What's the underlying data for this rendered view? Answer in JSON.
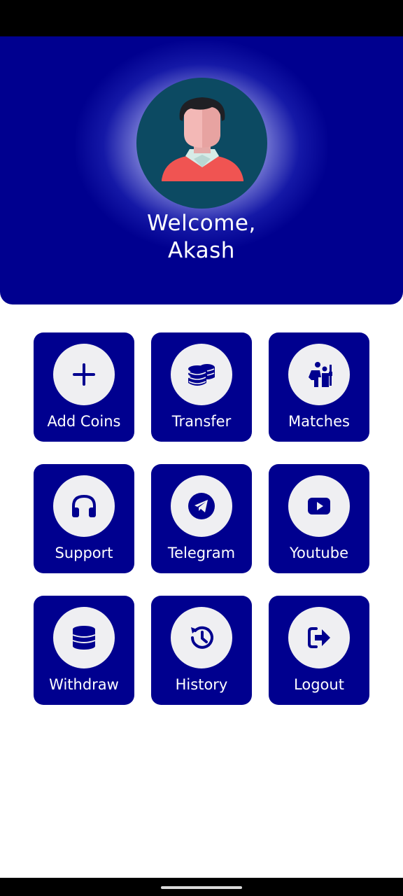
{
  "header": {
    "welcome_line1": "Welcome,",
    "welcome_line2": "Akash",
    "background_color": "#00008f",
    "avatar_icon": "user-avatar-icon"
  },
  "menu": {
    "tile_color": "#00008f",
    "icon_color": "#00008f",
    "icon_background": "#efeff2",
    "items": [
      {
        "label": "Add Coins",
        "icon": "plus-icon"
      },
      {
        "label": "Transfer",
        "icon": "coins-icon"
      },
      {
        "label": "Matches",
        "icon": "soldiers-icon"
      },
      {
        "label": "Support",
        "icon": "headphones-icon"
      },
      {
        "label": "Telegram",
        "icon": "telegram-icon"
      },
      {
        "label": "Youtube",
        "icon": "youtube-icon"
      },
      {
        "label": "Withdraw",
        "icon": "database-icon"
      },
      {
        "label": "History",
        "icon": "history-icon"
      },
      {
        "label": "Logout",
        "icon": "logout-icon"
      }
    ]
  }
}
